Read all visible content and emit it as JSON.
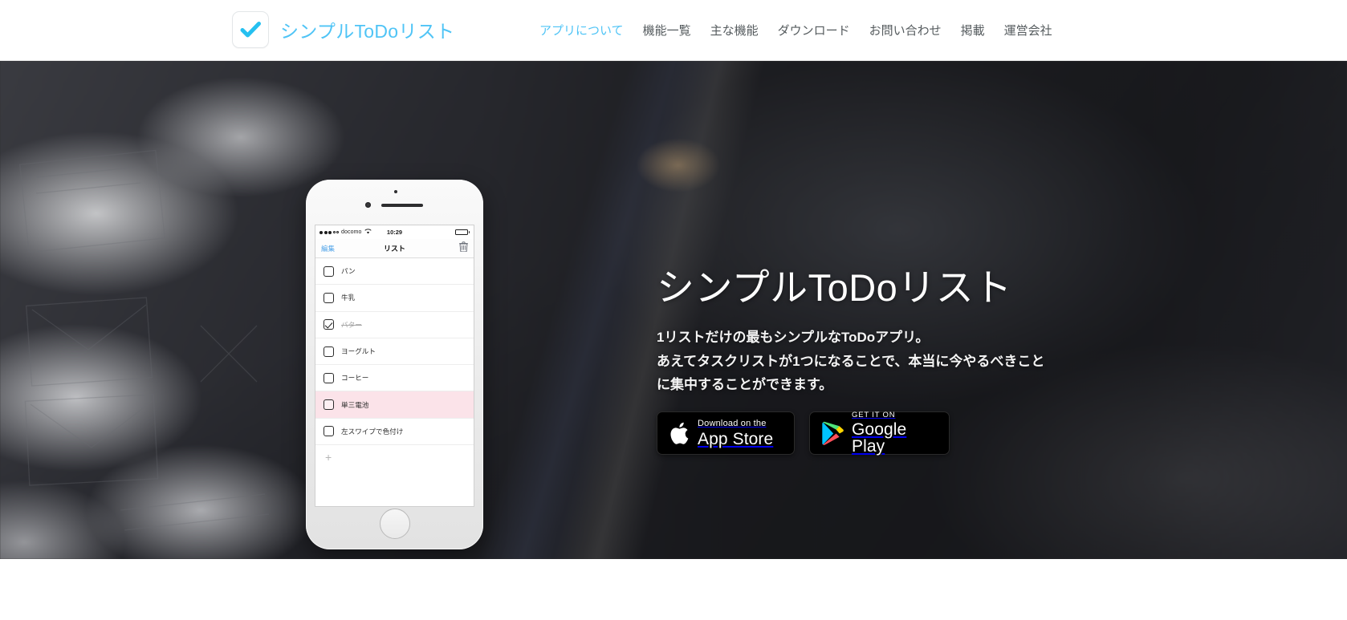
{
  "header": {
    "brand_name": "シンプルToDoリスト",
    "logo_icon": "checkmark-icon",
    "nav": [
      {
        "label": "アプリについて",
        "active": true
      },
      {
        "label": "機能一覧",
        "active": false
      },
      {
        "label": "主な機能",
        "active": false
      },
      {
        "label": "ダウンロード",
        "active": false
      },
      {
        "label": "お問い合わせ",
        "active": false
      },
      {
        "label": "掲載",
        "active": false
      },
      {
        "label": "運営会社",
        "active": false
      }
    ]
  },
  "hero": {
    "title": "シンプルToDoリスト",
    "subtitle_line1": "1リストだけの最もシンプルなToDoアプリ。",
    "subtitle_line2": "あえてタスクリストが1つになることで、本当に今やるべきこと",
    "subtitle_line3": "に集中することができます。",
    "badges": {
      "appstore": {
        "small": "Download on the",
        "big": "App Store",
        "icon": "apple-logo-icon"
      },
      "googleplay": {
        "small": "GET IT ON",
        "big": "Google Play",
        "icon": "google-play-icon"
      }
    }
  },
  "phone": {
    "status_bar": {
      "carrier": "docomo",
      "time": "10:29",
      "wifi_icon": "wifi-icon",
      "battery_icon": "battery-full-icon"
    },
    "app_navbar": {
      "edit_label": "編集",
      "title": "リスト",
      "trash_icon": "trash-icon"
    },
    "todos": [
      {
        "label": "パン",
        "checked": false,
        "highlight": false
      },
      {
        "label": "牛乳",
        "checked": false,
        "highlight": false
      },
      {
        "label": "バター",
        "checked": true,
        "highlight": false
      },
      {
        "label": "ヨーグルト",
        "checked": false,
        "highlight": false
      },
      {
        "label": "コーヒー",
        "checked": false,
        "highlight": false
      },
      {
        "label": "単三電池",
        "checked": false,
        "highlight": true
      },
      {
        "label": "左スワイプで色付け",
        "checked": false,
        "highlight": false
      }
    ],
    "add_row_label": "+"
  },
  "colors": {
    "brand_blue": "#4fc4f6",
    "nav_text": "#555b5e",
    "highlight_pink": "#fbe3e9",
    "badge_black": "#000000"
  }
}
